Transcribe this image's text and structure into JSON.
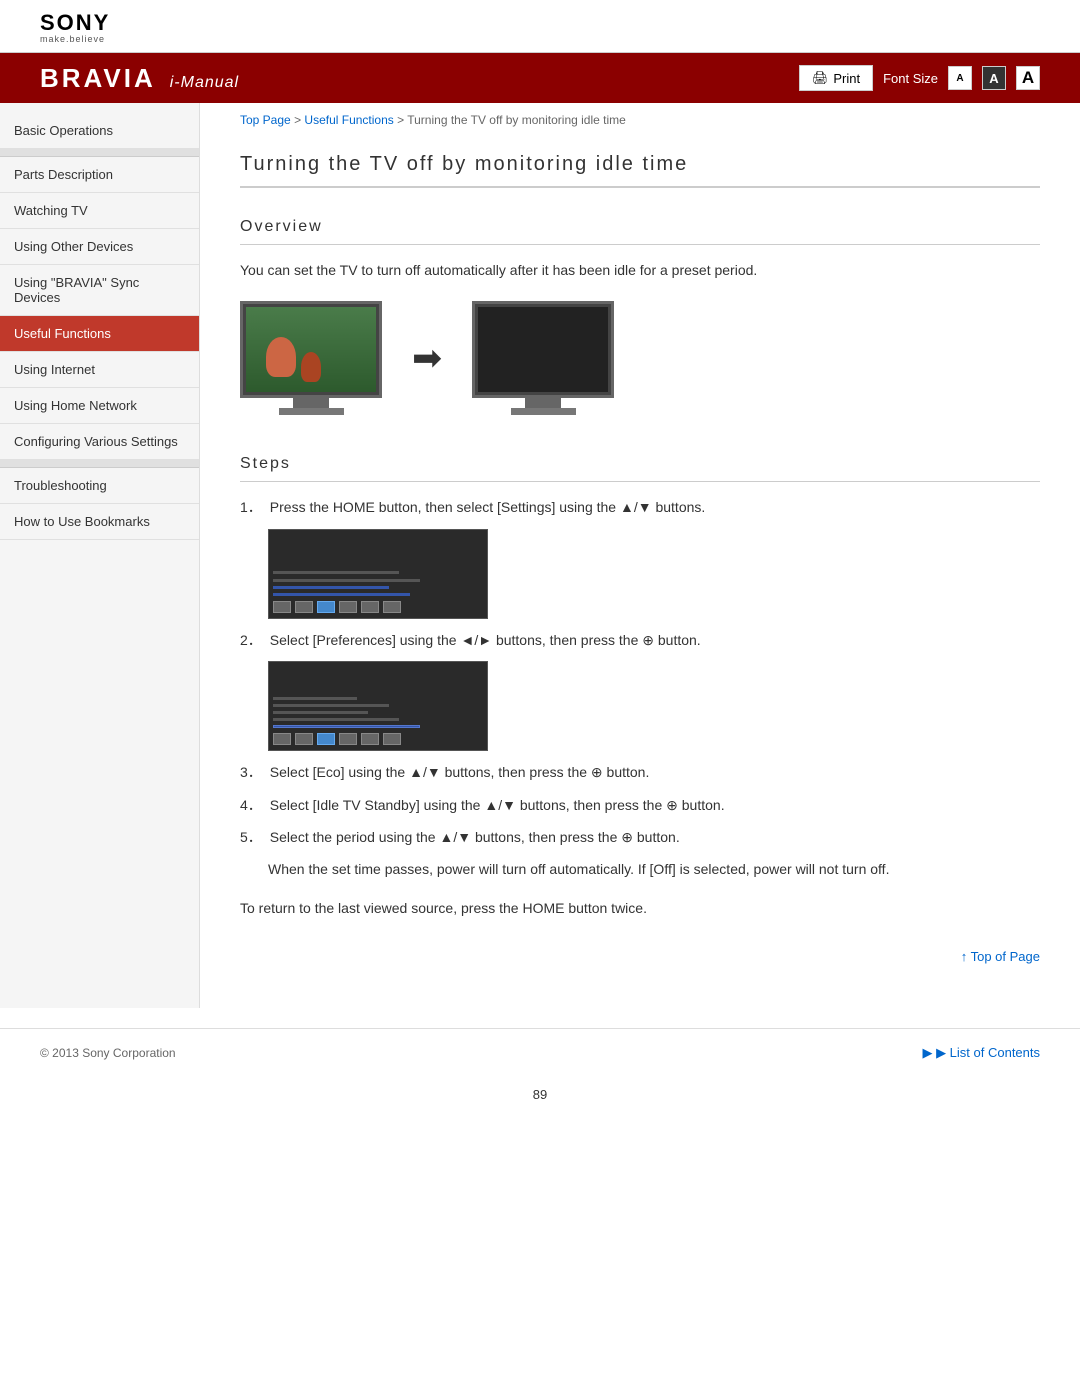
{
  "header": {
    "sony_logo": "SONY",
    "sony_tagline": "make.believe",
    "bravia_text": "BRAVIA",
    "imanual_text": "i-Manual",
    "print_label": "Print",
    "font_size_label": "Font Size",
    "font_a_small": "A",
    "font_a_medium": "A",
    "font_a_large": "A"
  },
  "breadcrumb": {
    "top_page": "Top Page",
    "useful_functions": "Useful Functions",
    "current": "Turning the TV off by monitoring idle time"
  },
  "sidebar": {
    "items": [
      {
        "id": "basic-operations",
        "label": "Basic Operations",
        "active": false
      },
      {
        "id": "parts-description",
        "label": "Parts Description",
        "active": false
      },
      {
        "id": "watching-tv",
        "label": "Watching TV",
        "active": false
      },
      {
        "id": "using-other-devices",
        "label": "Using Other Devices",
        "active": false
      },
      {
        "id": "using-bravia-sync",
        "label": "Using \"BRAVIA\" Sync Devices",
        "active": false
      },
      {
        "id": "useful-functions",
        "label": "Useful Functions",
        "active": true
      },
      {
        "id": "using-internet",
        "label": "Using Internet",
        "active": false
      },
      {
        "id": "using-home-network",
        "label": "Using Home Network",
        "active": false
      },
      {
        "id": "configuring-settings",
        "label": "Configuring Various Settings",
        "active": false
      },
      {
        "id": "troubleshooting",
        "label": "Troubleshooting",
        "active": false
      },
      {
        "id": "how-to-bookmarks",
        "label": "How to Use Bookmarks",
        "active": false
      }
    ]
  },
  "page": {
    "title": "Turning the TV off by monitoring idle time",
    "overview_header": "Overview",
    "overview_text": "You can set the TV to turn off automatically after it has been idle for a preset period.",
    "steps_header": "Steps",
    "steps": [
      {
        "num": "1",
        "text": "Press the HOME button, then select [Settings] using the ▲/▼ buttons."
      },
      {
        "num": "2",
        "text": "Select  [Preferences] using the ◄/► buttons, then press the ⊕ button."
      },
      {
        "num": "3",
        "text": "Select [Eco] using the ▲/▼ buttons, then press the ⊕ button."
      },
      {
        "num": "4",
        "text": "Select [Idle TV Standby] using the ▲/▼ buttons, then press the ⊕ button."
      },
      {
        "num": "5",
        "text": "Select the period using the ▲/▼ buttons, then press the ⊕ button."
      }
    ],
    "note": "When the set time passes, power will turn off automatically. If [Off] is selected, power will not turn off.",
    "return_text": "To return to the last viewed source, press the HOME button twice.",
    "top_of_page": "Top of Page",
    "list_of_contents": "List of Contents",
    "copyright": "© 2013 Sony Corporation",
    "page_number": "89"
  }
}
